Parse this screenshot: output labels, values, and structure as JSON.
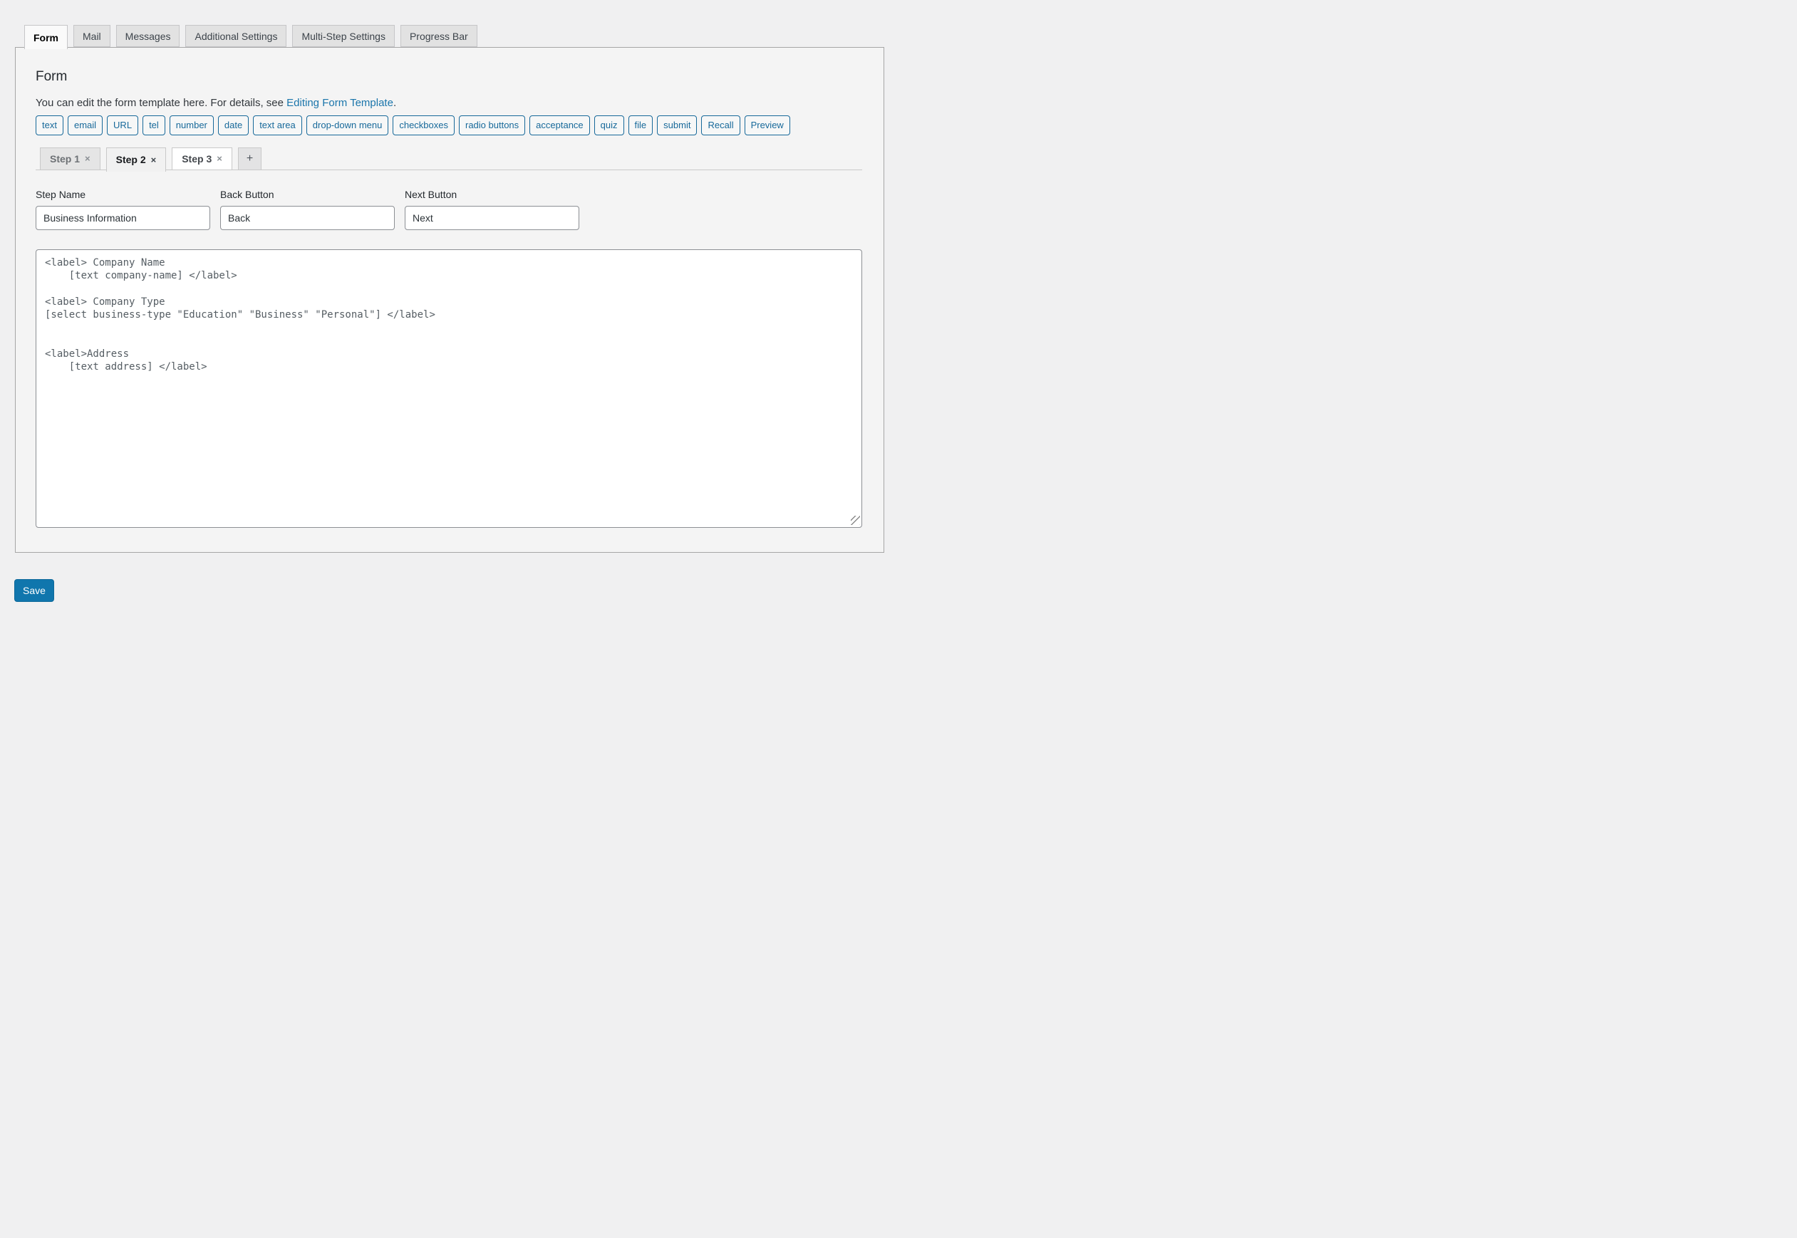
{
  "top_tabs": {
    "items": [
      {
        "label": "Form",
        "active": true
      },
      {
        "label": "Mail",
        "active": false
      },
      {
        "label": "Messages",
        "active": false
      },
      {
        "label": "Additional Settings",
        "active": false
      },
      {
        "label": "Multi-Step Settings",
        "active": false
      },
      {
        "label": "Progress Bar",
        "active": false
      }
    ]
  },
  "panel": {
    "title": "Form",
    "description": {
      "text_before_link": "You can edit the form template here. For details, see ",
      "link_text": "Editing Form Template",
      "text_after_link": "."
    },
    "tag_buttons": [
      "text",
      "email",
      "URL",
      "tel",
      "number",
      "date",
      "text area",
      "drop-down menu",
      "checkboxes",
      "radio buttons",
      "acceptance",
      "quiz",
      "file",
      "submit",
      "Recall",
      "Preview"
    ],
    "step_tabs": {
      "items": [
        {
          "label": "Step 1",
          "close": "×",
          "active": false
        },
        {
          "label": "Step 2",
          "close": "×",
          "active": true
        },
        {
          "label": "Step 3",
          "close": "×",
          "active": false
        }
      ],
      "add_label": "+"
    },
    "fields": [
      {
        "label": "Step Name",
        "value": "Business Information"
      },
      {
        "label": "Back Button",
        "value": "Back"
      },
      {
        "label": "Next Button",
        "value": "Next"
      }
    ],
    "form_template": "<label> Company Name\n    [text company-name] </label>\n\n<label> Company Type\n[select business-type \"Education\" \"Business\" \"Personal\"] </label>\n\n\n<label>Address\n    [text address] </label>"
  },
  "save": {
    "label": "Save"
  },
  "colors": {
    "page_bg": "#f0f0f1",
    "panel_bg": "#f4f4f4",
    "tag_button_blue": "#17699a",
    "link_blue": "#1a75ab",
    "save_blue": "#1076ad",
    "active_step_bg": "#f1f1f1",
    "inactive_tab_bg": "#e2e2e2"
  }
}
